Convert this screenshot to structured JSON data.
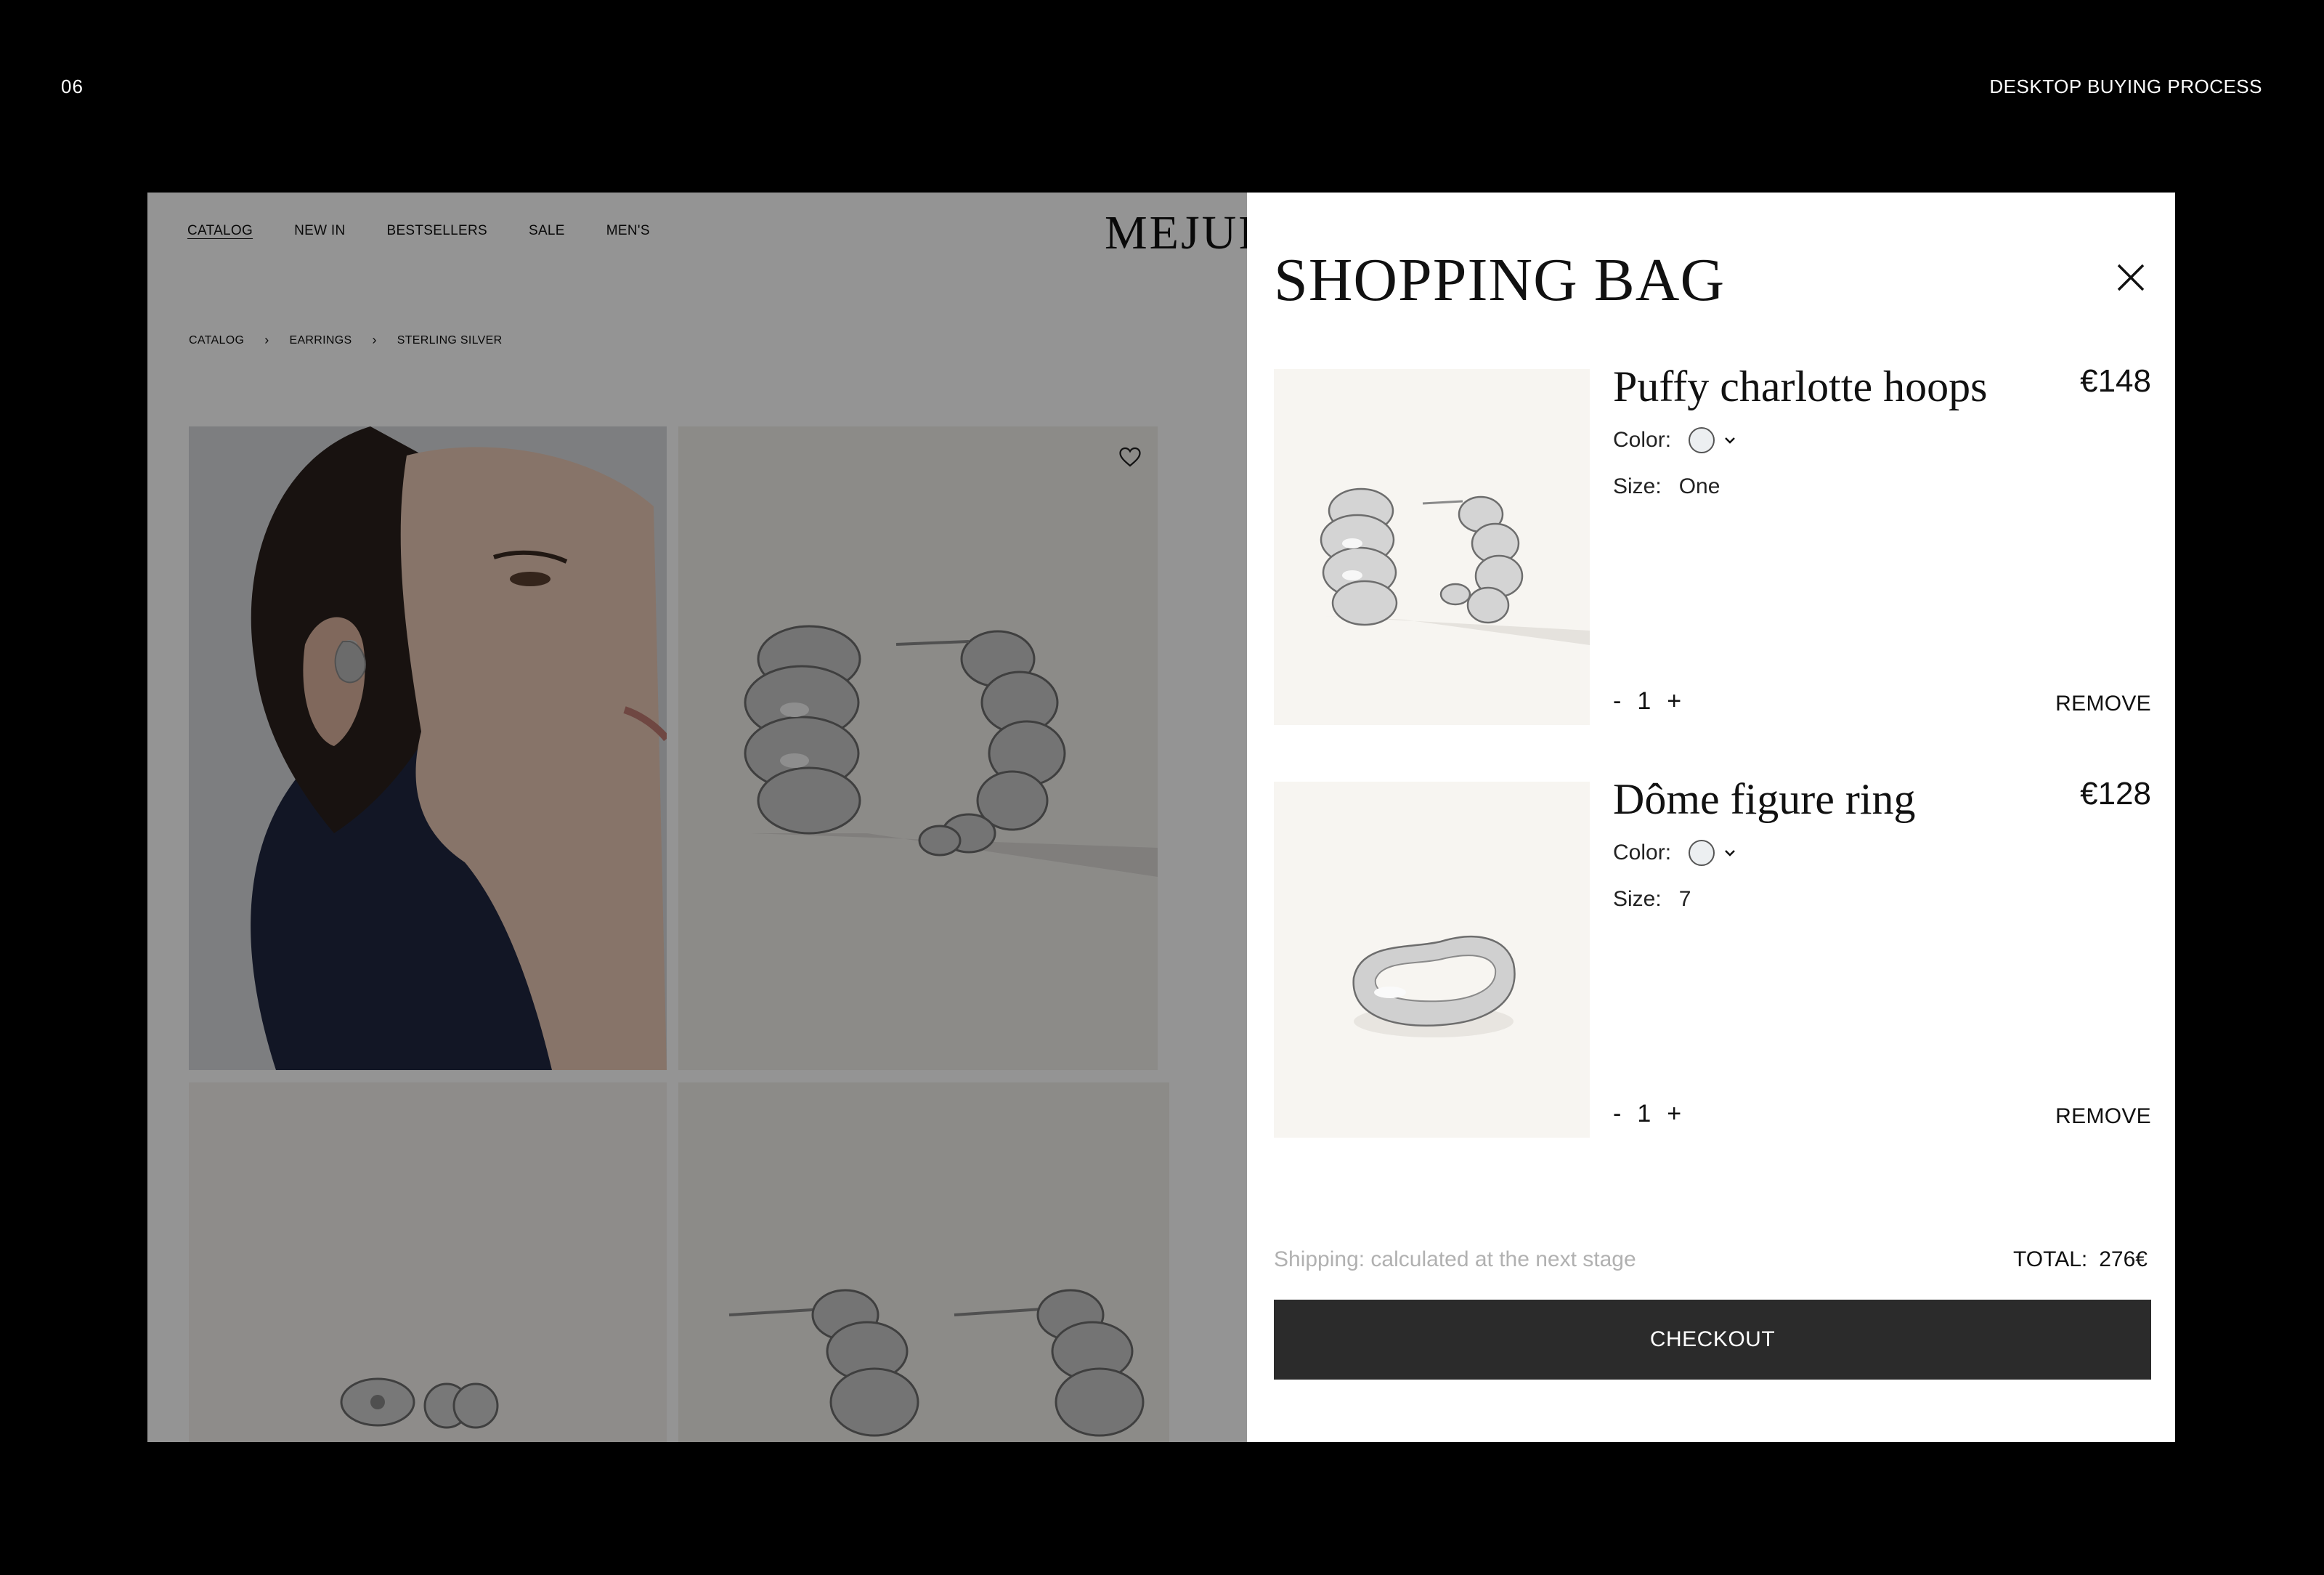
{
  "slide": {
    "number": "06",
    "title": "DESKTOP BUYING PROCESS"
  },
  "store": {
    "nav": [
      "CATALOG",
      "NEW IN",
      "BESTSELLERS",
      "SALE",
      "MEN'S"
    ],
    "logo": "MEJURI",
    "breadcrumb": [
      "CATALOG",
      "EARRINGS",
      "STERLING SILVER"
    ]
  },
  "bag": {
    "title": "SHOPPING BAG",
    "items": [
      {
        "name": "Puffy charlotte hoops",
        "price": "€148",
        "color_label": "Color:",
        "size_label": "Size:",
        "size": "One",
        "qty": "1",
        "minus": "-",
        "plus": "+",
        "remove": "REMOVE"
      },
      {
        "name": "Dôme figure ring",
        "price": "€128",
        "color_label": "Color:",
        "size_label": "Size:",
        "size": "7",
        "qty": "1",
        "minus": "-",
        "plus": "+",
        "remove": "REMOVE"
      }
    ],
    "shipping": "Shipping: calculated at the next stage",
    "total_label": "TOTAL:",
    "total_value": "276€",
    "checkout": "CHECKOUT"
  },
  "colors": {
    "overlay": "#000000",
    "button": "#2b2b2b",
    "thumb_bg": "#f7f5f1"
  }
}
